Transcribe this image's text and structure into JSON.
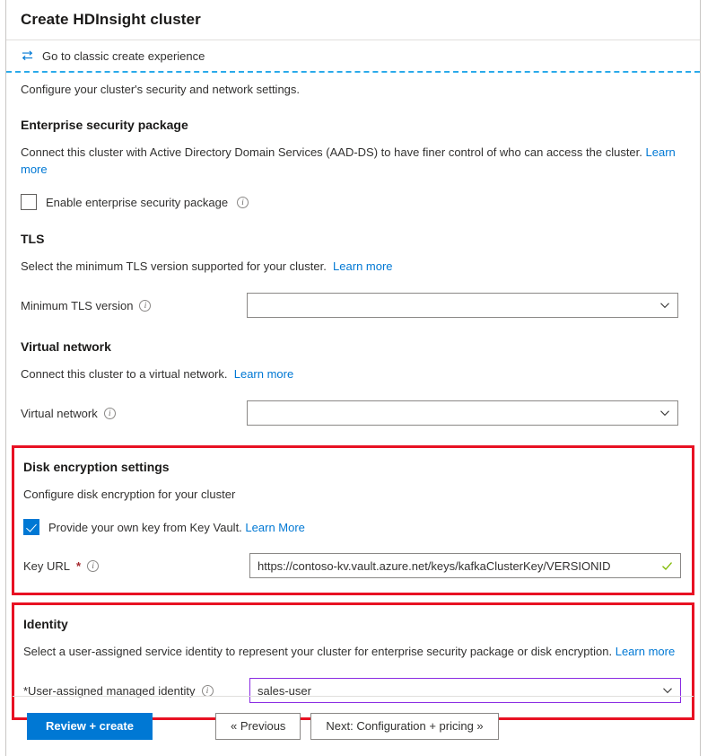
{
  "window": {
    "title": "Create HDInsight cluster"
  },
  "classic_link": {
    "icon": "swap-arrows-icon",
    "label": "Go to classic create experience"
  },
  "intro": "Configure your cluster's security and network settings.",
  "sections": {
    "enterprise_security": {
      "title": "Enterprise security package",
      "description": "Connect this cluster with Active Directory Domain Services (AAD-DS) to have finer control of who can access the cluster.",
      "learn_more": "Learn more",
      "checkbox": {
        "label": "Enable enterprise security package",
        "checked": false,
        "info_icon": "info-icon"
      }
    },
    "tls": {
      "title": "TLS",
      "description": "Select the minimum TLS version supported for your cluster.",
      "learn_more": "Learn more",
      "field": {
        "label": "Minimum TLS version",
        "value": "",
        "info_icon": "info-icon",
        "chevron_icon": "chevron-down-icon"
      }
    },
    "virtual_network": {
      "title": "Virtual network",
      "description": "Connect this cluster to a virtual network.",
      "learn_more": "Learn more",
      "field": {
        "label": "Virtual network",
        "value": "",
        "info_icon": "info-icon",
        "chevron_icon": "chevron-down-icon"
      }
    },
    "disk_encryption": {
      "title": "Disk encryption settings",
      "description": "Configure disk encryption for your cluster",
      "checkbox": {
        "label": "Provide your own key from Key Vault.",
        "checked": true
      },
      "learn_more": "Learn More",
      "field": {
        "label": "Key URL",
        "required_marker": "*",
        "value": "https://contoso-kv.vault.azure.net/keys/kafkaClusterKey/VERSIONID",
        "info_icon": "info-icon",
        "validation_icon": "green-check-icon"
      },
      "highlight_color": "#e81123"
    },
    "identity": {
      "title": "Identity",
      "description": "Select a user-assigned service identity to represent your cluster for enterprise security package or disk encryption.",
      "learn_more": "Learn more",
      "field": {
        "label": "*User-assigned managed identity",
        "value": "sales-user",
        "info_icon": "info-icon",
        "chevron_icon": "chevron-down-icon",
        "border_color": "#8a2be2"
      },
      "highlight_color": "#e81123"
    }
  },
  "footer": {
    "review_create": "Review + create",
    "previous": "« Previous",
    "next": "Next: Configuration + pricing »"
  },
  "colors": {
    "accent": "#0078d4",
    "link": "#0078d4",
    "highlight": "#e81123",
    "required": "#a4262c",
    "divider_dashed": "#2aaaea",
    "identity_border": "#8a2be2",
    "validation_green": "#7fba00"
  }
}
